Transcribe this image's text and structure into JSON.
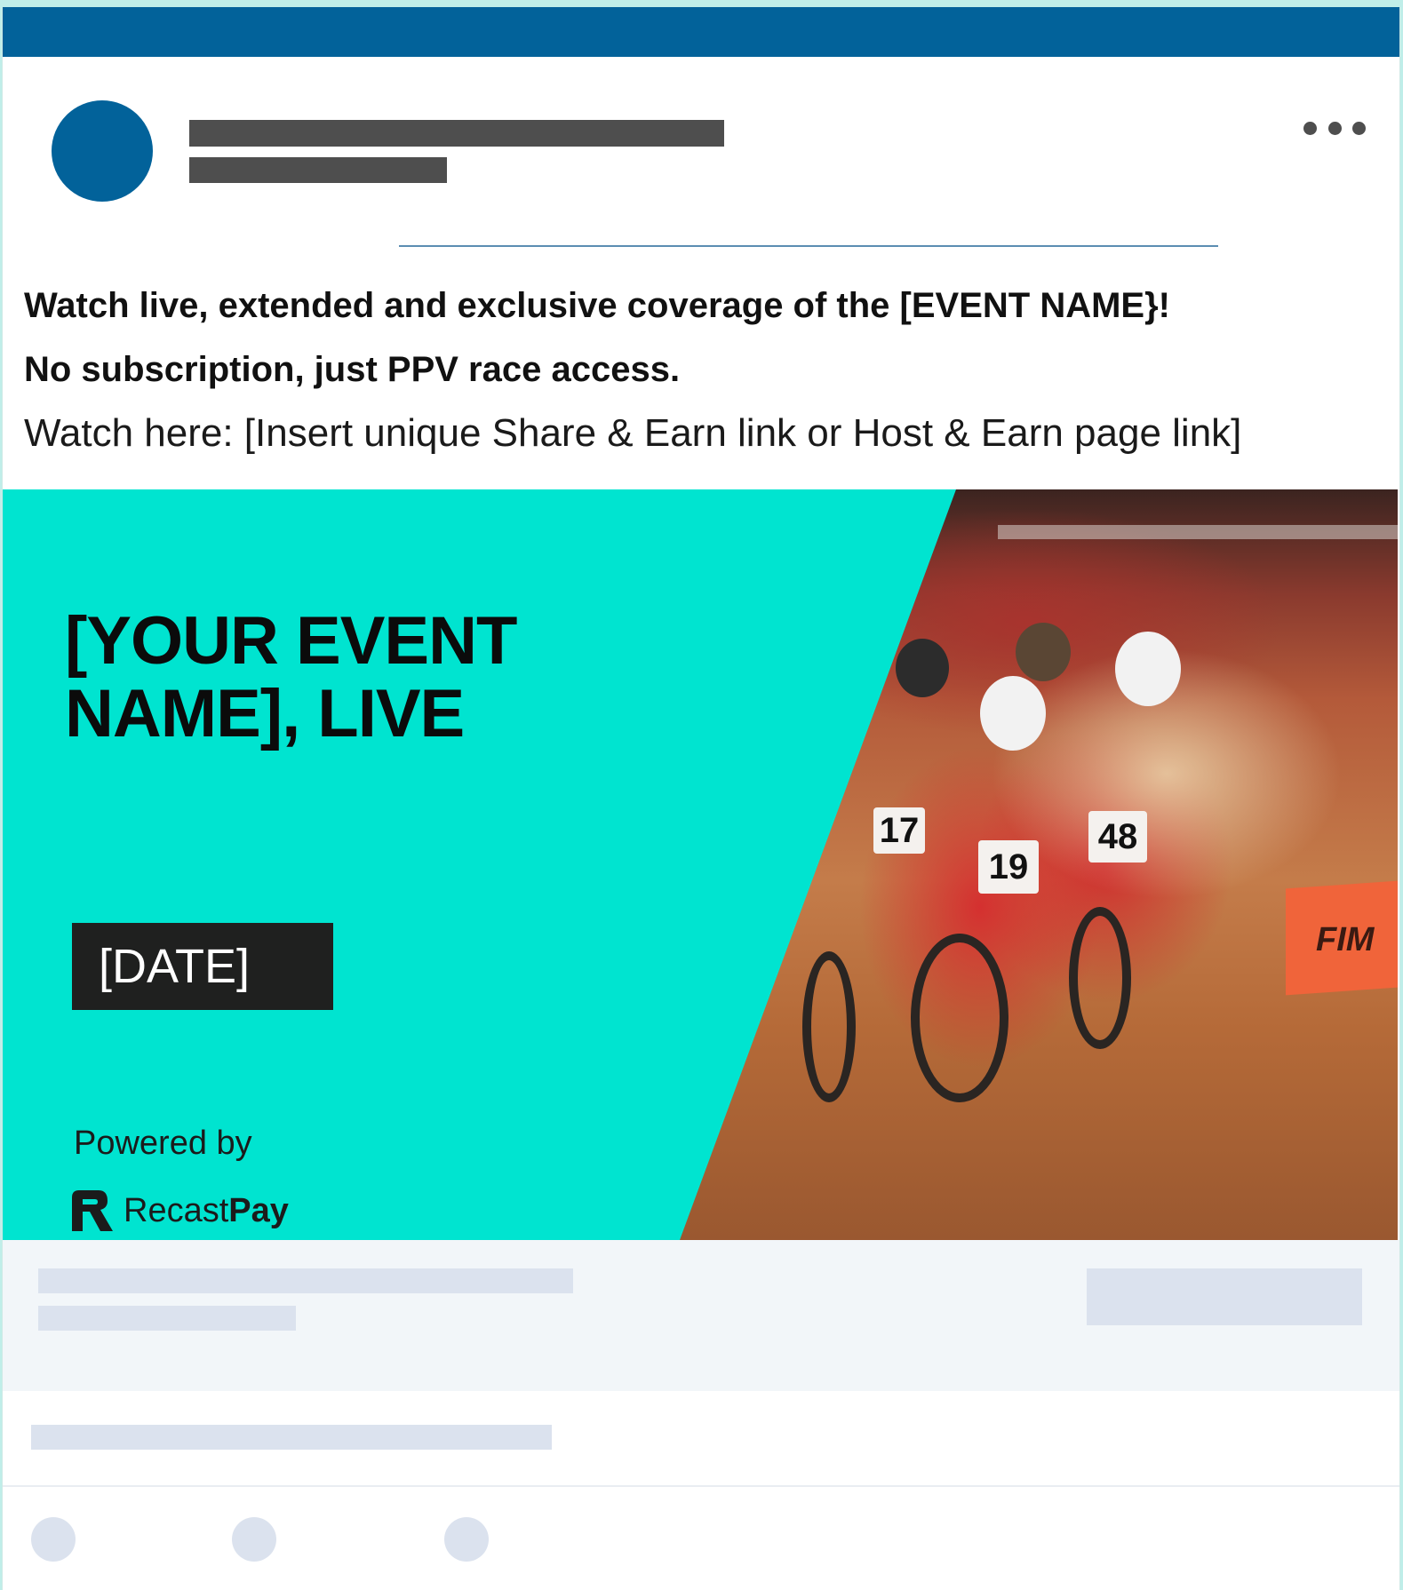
{
  "post": {
    "headline_line1": "Watch live, extended and exclusive coverage of the  [EVENT NAME}!",
    "headline_line2": "No subscription, just PPV race access.",
    "link_line": "Watch here: [Insert unique Share & Earn link or Host & Earn page link]"
  },
  "banner": {
    "event_title_line1": "[YOUR EVENT",
    "event_title_line2": "NAME], LIVE",
    "date_label": "[DATE]",
    "powered_by": "Powered by",
    "brand_regular": "Recast",
    "brand_bold": "Pay",
    "photo_numbers": [
      "17",
      "19",
      "48"
    ],
    "photo_sign": "FIM"
  },
  "colors": {
    "brand_blue": "#02629a",
    "banner_teal": "#00e4d0",
    "date_button": "#1f201f",
    "placeholder_dark": "#4e4e4e",
    "placeholder_light": "#dbe2ee"
  },
  "icons": [
    "more-options-icon",
    "recastpay-logo-icon",
    "avatar-placeholder"
  ]
}
